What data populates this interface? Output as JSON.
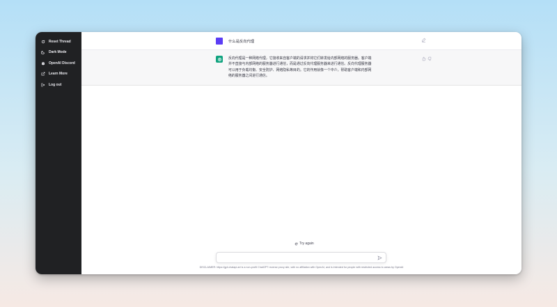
{
  "sidebar": {
    "items": [
      {
        "label": "Reset Thread",
        "icon": "refresh-icon"
      },
      {
        "label": "Dark Mode",
        "icon": "moon-icon"
      },
      {
        "label": "OpenAI Discord",
        "icon": "discord-icon"
      },
      {
        "label": "Learn More",
        "icon": "external-link-icon"
      },
      {
        "label": "Log out",
        "icon": "logout-icon"
      }
    ]
  },
  "conversation": {
    "user_message": "什么是反向代理",
    "assistant_message": "反向代理是一种网络代理，它接收来自客户端的请求并将它们转发给内部网络的服务器。客户端并不直接与内部网络的服务器进行通信，而是通过反向代理服务器来进行通信。反向代理服务器可以用于负载均衡、安全防护、网络隐私等目的。它的作用就像一个中介，帮助客户端和内部网络的服务器之间进行通信。"
  },
  "actions": {
    "retry_label": "Try again"
  },
  "input": {
    "placeholder": "",
    "value": ""
  },
  "footer": {
    "disclaimer": "DISCLAIMER: https://gpt.chatapi.art is a non-profit ChatGPT reverse proxy site, with no affiliation with OpenAI, and is intended for people with restricted access to areas by OpenAI"
  },
  "colors": {
    "sidebar_bg": "#202123",
    "user_avatar": "#5b3df5",
    "assistant_avatar": "#10a37f"
  }
}
